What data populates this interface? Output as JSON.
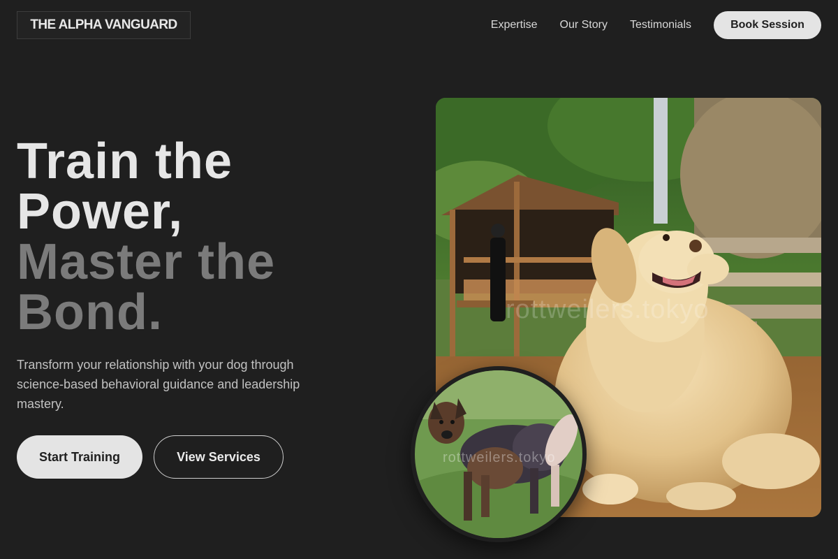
{
  "header": {
    "brand": "THE ALPHA VANGUARD",
    "nav": [
      "Expertise",
      "Our Story",
      "Testimonials"
    ],
    "cta": "Book Session"
  },
  "hero": {
    "headline": {
      "line1": "Train the",
      "line2": "Power,",
      "line3": "Master the",
      "line4": "Bond."
    },
    "subtitle": "Transform your relationship with your dog through science-based behavioral guidance and leadership mastery.",
    "primary_button": "Start Training",
    "secondary_button": "View Services",
    "main_image": {
      "icon": "golden-retriever-photo",
      "watermark": "rottweilers.tokyo"
    },
    "inset_image": {
      "icon": "shepherd-mix-dog-photo",
      "watermark": "rottweilers.tokyo"
    }
  },
  "colors": {
    "background": "#1f1f1f",
    "primary_button": "#e4e4e4",
    "headline_light": "#e6e6e6",
    "headline_muted": "#7b7b7b"
  }
}
